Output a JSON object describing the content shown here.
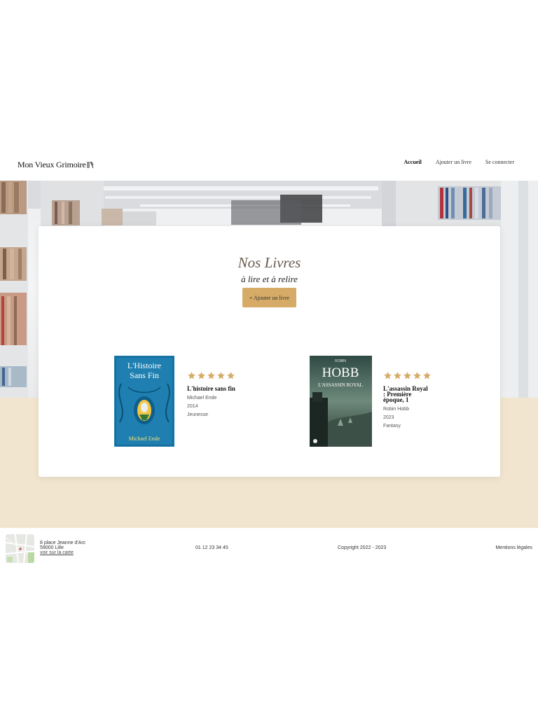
{
  "header": {
    "logo_text": "Mon Vieux Grimoire",
    "nav": [
      "Accueil",
      "Ajouter un livre",
      "Se connecter"
    ]
  },
  "main": {
    "title": "Nos Livres",
    "subtitle": "à lire et à relire",
    "add_button_label": "+ Ajouter un livre"
  },
  "books": [
    {
      "title": "L'histoire sans fin",
      "author": "Michael Ende",
      "year": "2014",
      "genre": "Jeunesse",
      "rating": 5,
      "cover_text": {
        "line1": "L'Histoire",
        "line2": "Sans Fin",
        "author": "Michael Ende"
      }
    },
    {
      "title": "L'assassin Royal : Première époque, 1",
      "author": "Robin Hobb",
      "year": "2023",
      "genre": "Fantasy",
      "rating": 5,
      "cover_text": {
        "author_first": "ROBIN",
        "author_last": "HOBB",
        "title": "L'ASSASSIN ROYAL"
      }
    }
  ],
  "footer": {
    "address_line1": "8 place Jeanne d'Arc",
    "address_line2": "59000 Lille",
    "map_link": "voir sur la carte",
    "phone": "01 12 23 34 45",
    "copyright": "Copyright 2022 - 2023",
    "legal": "Mentions légales"
  },
  "colors": {
    "accent": "#d6ab67",
    "beige_band": "#f1e5cf",
    "title_brown": "#6a5a4d",
    "star_gold": "#d6ab67"
  },
  "icons": [
    "logo-book-icon",
    "star-icon",
    "map-thumbnail"
  ]
}
